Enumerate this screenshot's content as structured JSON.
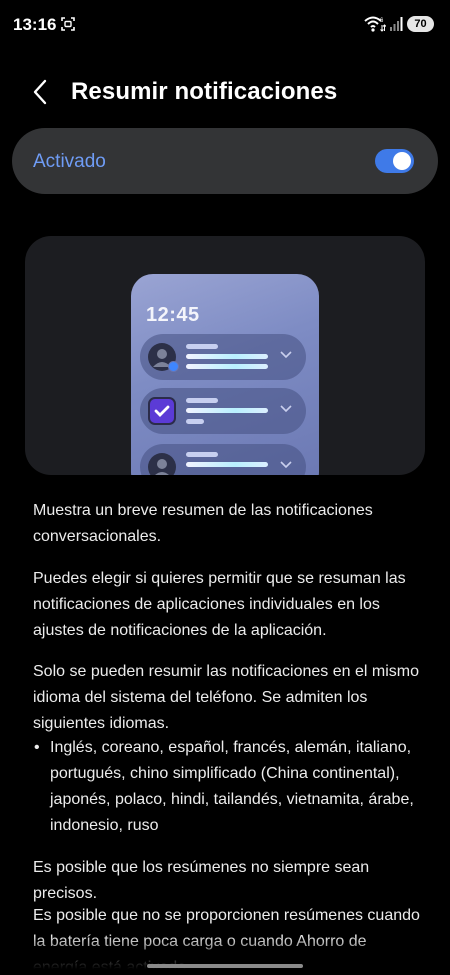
{
  "status_bar": {
    "time": "13:16",
    "battery": "70",
    "icons": [
      "screenshot-icon",
      "wifi-icon",
      "signal-icon",
      "battery-icon"
    ]
  },
  "header": {
    "title": "Resumir notificaciones",
    "back_icon": "back-chevron-icon"
  },
  "toggle": {
    "label": "Activado",
    "state": true,
    "accent_color": "#3f7ae8",
    "label_color": "#6f9cf5"
  },
  "illustration": {
    "clock": "12:45"
  },
  "body": {
    "p1": "Muestra un breve resumen de las notificaciones conversacionales.",
    "p2": "Puedes elegir si quieres permitir que se resuman las notificaciones de aplicaciones individuales en los ajustes de notificaciones de la aplicación.",
    "p3": "Solo se pueden resumir las notificaciones en el mismo idioma del sistema del teléfono. Se admiten los siguientes idiomas.",
    "bullet_marker": "•",
    "languages": "Inglés, coreano, español, francés, alemán, italiano, portugués, chino simplificado (China continental), japonés, polaco, hindi, tailandés, vietnamita, árabe, indonesio, ruso",
    "p4": "Es posible que los resúmenes no siempre sean precisos.",
    "p5": "Es posible que no se proporcionen resúmenes cuando la batería tiene poca carga o cuando Ahorro de energía está activado."
  }
}
